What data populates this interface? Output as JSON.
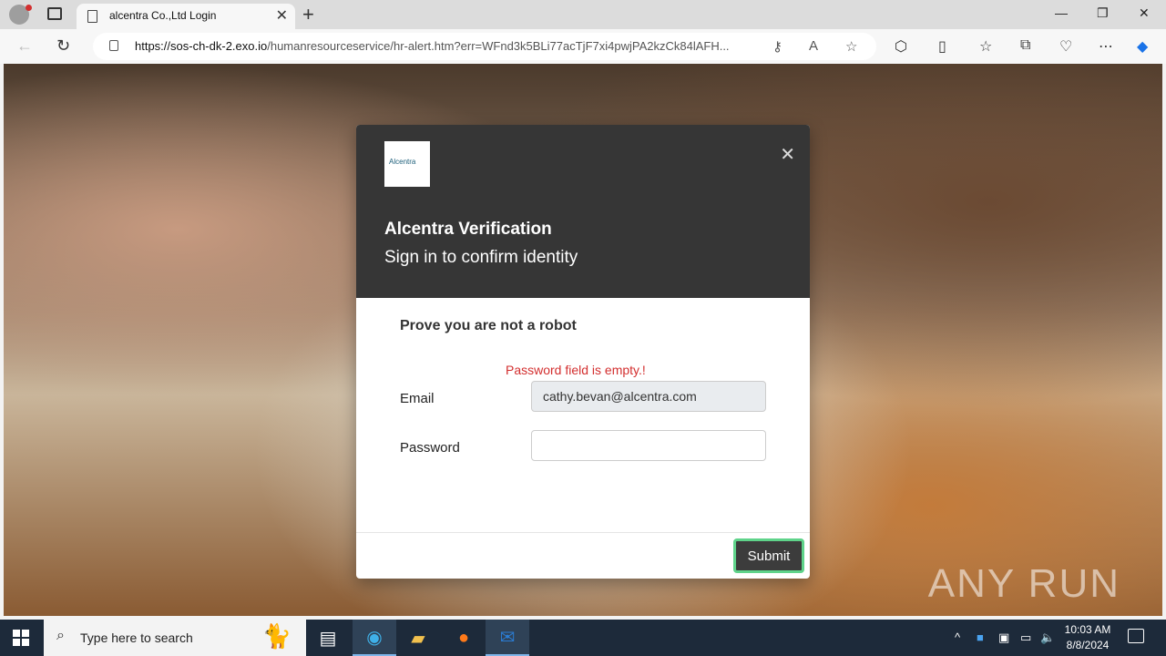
{
  "browser": {
    "tab_title": "alcentra Co.,Ltd Login",
    "url_domain": "https://sos-ch-dk-2.exo.io",
    "url_path": "/humanresourceservice/hr-alert.htm?err=WFnd3k5BLi77acTjF7xi4pwjPA2kzCk84lAFH..."
  },
  "modal": {
    "logo_text": "Alcentra",
    "title": "Alcentra Verification",
    "subtitle": "Sign in to confirm identity",
    "robot_heading": "Prove you are not a robot",
    "error": "Password field is empty.!",
    "email_label": "Email",
    "email_value": "cathy.bevan@alcentra.com",
    "password_label": "Password",
    "password_value": "",
    "submit_label": "Submit"
  },
  "watermark": "ANY RUN",
  "taskbar": {
    "search_placeholder": "Type here to search",
    "time": "10:03 AM",
    "date": "8/8/2024"
  }
}
